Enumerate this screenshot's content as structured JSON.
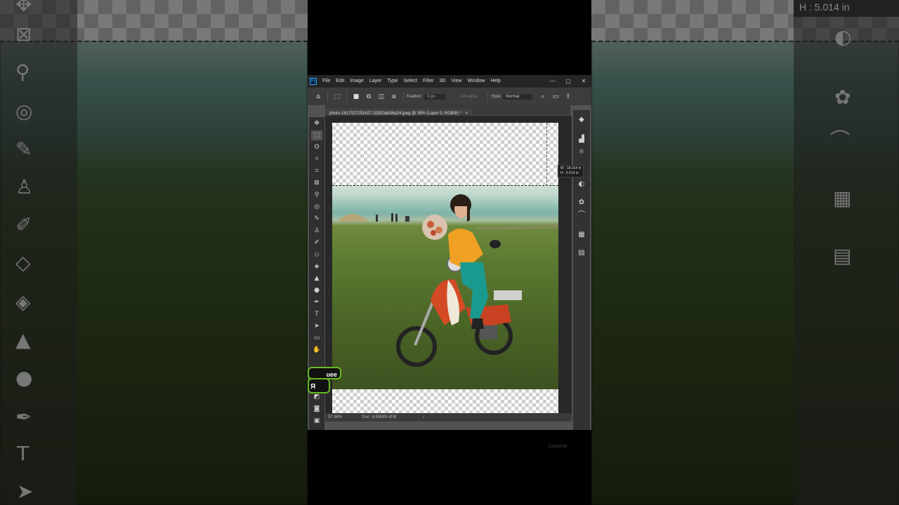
{
  "menubar": {
    "logo": "Ps",
    "items": [
      "File",
      "Edit",
      "Image",
      "Layer",
      "Type",
      "Select",
      "Filter",
      "3D",
      "View",
      "Window",
      "Help"
    ],
    "window_controls": [
      "—",
      "▢",
      "✕"
    ]
  },
  "options": {
    "feather_label": "Feather:",
    "feather_value": "0 px",
    "antialias_label": "Anti-alias",
    "style_label": "Style:",
    "style_value": "Normal"
  },
  "document": {
    "tab_title": "photo-1617027251627-32923ab36a24.jpeg @ 38% (Layer 0, RGB/8) *",
    "tab_close": "×"
  },
  "selection_readout": {
    "w": "W : 18.014 in",
    "h": "H : 5.014 in"
  },
  "status": {
    "zoom": "37.96%",
    "doc": "Doc: 6.50M/8.41M",
    "arrow": "›"
  },
  "side_readout": "H :   5.014 in",
  "badge": {
    "top": "uee",
    "bottom": "Я"
  },
  "watermark": "ZoomHub",
  "colors": {
    "accent": "#31a8ff",
    "ui_dark": "#262626",
    "ui_mid": "#3c3c3c",
    "badge_border": "#66bb22"
  },
  "icons": {
    "left_side": [
      "move-icon",
      "frame-icon",
      "eyedropper-icon",
      "patch-icon",
      "brush-icon",
      "stamp-icon",
      "history-brush-icon",
      "eraser-icon",
      "paint-bucket-icon",
      "triangle-icon",
      "dodge-icon",
      "pen-icon",
      "type-icon",
      "path-select-icon"
    ],
    "right_side": [
      "adjustments-icon",
      "channels-icon",
      "paths-icon",
      "grid-icon",
      "libraries-icon"
    ]
  }
}
